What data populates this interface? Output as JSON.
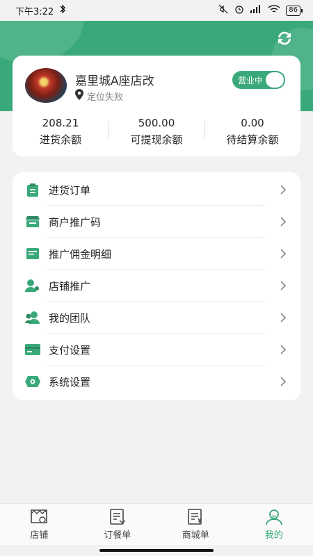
{
  "status_bar": {
    "time": "下午3:22",
    "battery": "86"
  },
  "profile": {
    "store_name": "嘉里城A座店改",
    "location_text": "定位失败",
    "business_status": "营业中"
  },
  "balances": [
    {
      "value": "208.21",
      "label": "进货余额"
    },
    {
      "value": "500.00",
      "label": "可提现余额"
    },
    {
      "value": "0.00",
      "label": "待结算余额"
    }
  ],
  "menu": [
    {
      "label": "进货订单",
      "icon": "clipboard-icon"
    },
    {
      "label": "商户推广码",
      "icon": "store-icon"
    },
    {
      "label": "推广佣金明细",
      "icon": "receipt-icon"
    },
    {
      "label": "店铺推广",
      "icon": "person-share-icon"
    },
    {
      "label": "我的团队",
      "icon": "team-icon"
    },
    {
      "label": "支付设置",
      "icon": "card-icon"
    },
    {
      "label": "系统设置",
      "icon": "eye-settings-icon"
    }
  ],
  "tabs": [
    {
      "label": "店铺",
      "icon": "shop-icon",
      "active": false
    },
    {
      "label": "订餐单",
      "icon": "order-icon",
      "active": false
    },
    {
      "label": "商城单",
      "icon": "mall-order-icon",
      "active": false
    },
    {
      "label": "我的",
      "icon": "profile-icon",
      "active": true
    }
  ],
  "colors": {
    "accent": "#3aa97a",
    "background": "#f2f2f2",
    "card": "#ffffff"
  }
}
